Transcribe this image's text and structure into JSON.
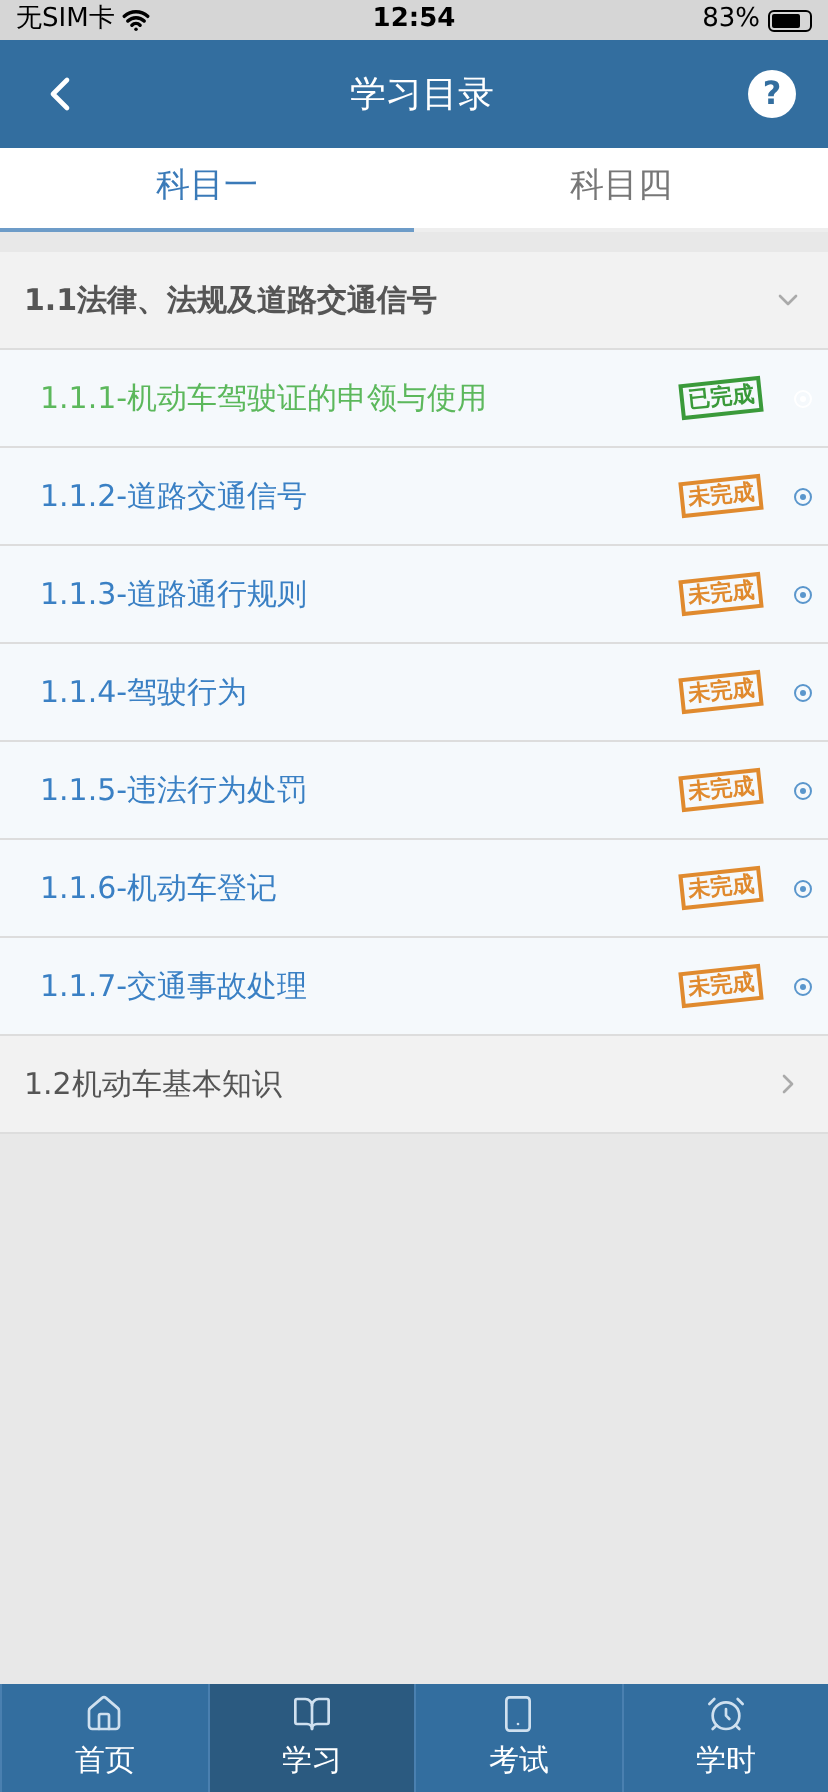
{
  "status_bar": {
    "carrier": "无SIM卡",
    "time": "12:54",
    "battery": "83%"
  },
  "header": {
    "title": "学习目录",
    "help": "?"
  },
  "tabs": [
    {
      "label": "科目一",
      "selected": true
    },
    {
      "label": "科目四",
      "selected": false
    }
  ],
  "sections": [
    {
      "title": "1.1法律、法规及道路交通信号",
      "expanded": true,
      "items": [
        {
          "label": "1.1.1-机动车驾驶证的申领与使用",
          "stamp": "已完成",
          "completed": true
        },
        {
          "label": "1.1.2-道路交通信号",
          "stamp": "未完成",
          "completed": false
        },
        {
          "label": "1.1.3-道路通行规则",
          "stamp": "未完成",
          "completed": false
        },
        {
          "label": "1.1.4-驾驶行为",
          "stamp": "未完成",
          "completed": false
        },
        {
          "label": "1.1.5-违法行为处罚",
          "stamp": "未完成",
          "completed": false
        },
        {
          "label": "1.1.6-机动车登记",
          "stamp": "未完成",
          "completed": false
        },
        {
          "label": "1.1.7-交通事故处理",
          "stamp": "未完成",
          "completed": false
        }
      ]
    },
    {
      "title": "1.2机动车基本知识",
      "expanded": false
    }
  ],
  "bottom_nav": [
    {
      "label": "首页",
      "kind": "home",
      "selected": false
    },
    {
      "label": "学习",
      "kind": "study",
      "selected": true
    },
    {
      "label": "考试",
      "kind": "exam",
      "selected": false
    },
    {
      "label": "学时",
      "kind": "hours",
      "selected": false
    }
  ]
}
